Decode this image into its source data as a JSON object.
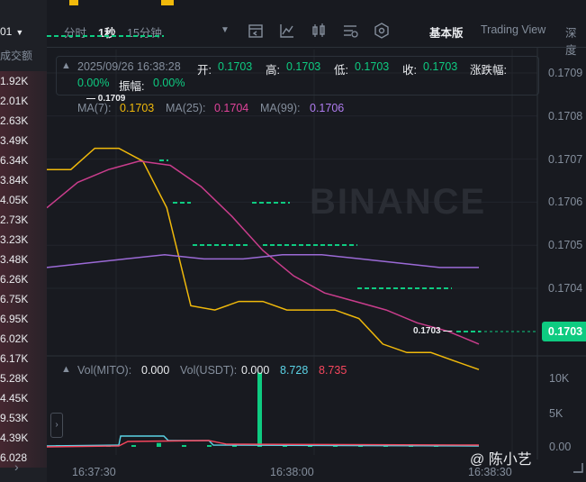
{
  "left_strip": {
    "pair_fragment": "01",
    "header": "成交额",
    "rows": [
      "1.92K",
      "2.01K",
      "2.63K",
      "3.49K",
      "6.34K",
      "3.84K",
      "4.05K",
      "2.73K",
      "3.23K",
      "3.48K",
      "6.26K",
      "6.75K",
      "6.95K",
      "6.02K",
      "6.17K",
      "5.28K",
      "4.45K",
      "9.53K",
      "4.39K",
      "6.028"
    ]
  },
  "toolbar": {
    "tab_time": "分时",
    "tab_1s": "1秒",
    "tab_15m": "15分钟",
    "view_basic": "基本版",
    "view_tradingview": "Trading View",
    "view_depth": "深度"
  },
  "ohlc": {
    "datetime": "2025/09/26 16:38:28",
    "open_label": "开:",
    "open": "0.1703",
    "high_label": "高:",
    "high": "0.1703",
    "low_label": "低:",
    "low": "0.1703",
    "close_label": "收:",
    "close": "0.1703",
    "change_label": "涨跌幅:",
    "change": "0.00%",
    "amp_label": "振幅:",
    "amp": "0.00%"
  },
  "ma": {
    "ma7_label": "MA(7):",
    "ma7": "0.1703",
    "ma25_label": "MA(25):",
    "ma25": "0.1704",
    "ma99_label": "MA(99):",
    "ma99": "0.1706"
  },
  "price_axis": [
    "0.1709",
    "0.1708",
    "0.1707",
    "0.1706",
    "0.1705",
    "0.1704"
  ],
  "current_price": "0.1703",
  "high_marker": "0.1709",
  "low_marker": "0.1703",
  "volume": {
    "vol_mito_label": "Vol(MITO):",
    "vol_mito": "0.000",
    "vol_usdt_label": "Vol(USDT):",
    "vol_usdt": "0.000",
    "ma_a": "8.728",
    "ma_b": "8.735",
    "axis": [
      "10K",
      "5K",
      "0.00"
    ]
  },
  "time_axis": [
    "16:37:30",
    "16:38:00",
    "16:38:30"
  ],
  "watermark_brand": "BINANCE",
  "watermark_user": "@ 陈小艺",
  "colors": {
    "bg": "#181a20",
    "up": "#0ecb81",
    "down": "#f6465d",
    "ma7": "#f0b90b",
    "ma25": "#c93d8c",
    "ma99": "#9b6ad6",
    "price_line": "#d4a017"
  },
  "chart_data": [
    {
      "type": "line",
      "title": "",
      "series": [
        {
          "name": "MA(7)",
          "values": [
            0.17083,
            0.17083,
            0.17088,
            0.17088,
            0.17085,
            0.17074,
            0.17051,
            0.1705,
            0.17052,
            0.17052,
            0.1705,
            0.1705,
            0.1705,
            0.17048,
            0.17042,
            0.1704,
            0.1704,
            0.17038,
            0.17036
          ]
        },
        {
          "name": "MA(25)",
          "values": [
            0.17074,
            0.1708,
            0.17083,
            0.17085,
            0.17084,
            0.17079,
            0.17072,
            0.17064,
            0.17058,
            0.17054,
            0.17052,
            0.1705,
            0.17047,
            0.17045,
            0.17042
          ]
        },
        {
          "name": "MA(99)",
          "values": [
            0.1706,
            0.17061,
            0.17062,
            0.17063,
            0.17062,
            0.17062,
            0.17063,
            0.17063,
            0.17062,
            0.17061,
            0.1706,
            0.1706
          ]
        }
      ],
      "ylim": [
        0.17028,
        0.17093
      ]
    },
    {
      "type": "bar",
      "title": "",
      "series": [
        {
          "name": "Vol",
          "values": [
            0.2,
            0.1,
            0.3,
            0.1,
            0.6,
            0.1,
            0.2,
            0.4,
            11.5,
            0.2,
            0.1,
            0.2,
            0.1,
            0.1,
            0.4,
            0.1
          ]
        }
      ],
      "ylim": [
        0,
        12
      ]
    }
  ]
}
